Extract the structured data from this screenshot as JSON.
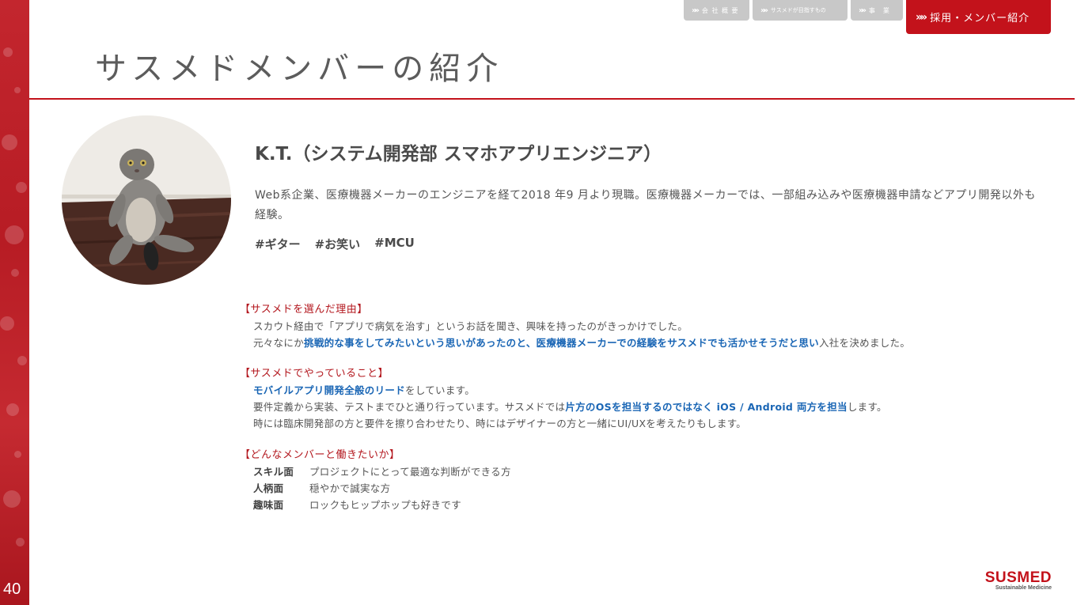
{
  "page_number": "40",
  "nav": {
    "tabs": [
      {
        "label": "会 社 概 要"
      },
      {
        "label": "サスメドが目指すもの"
      },
      {
        "label": "事　業"
      },
      {
        "label": "採用・メンバー紹介"
      }
    ]
  },
  "page_title": "サスメドメンバーの紹介",
  "member": {
    "name": "K.T.（システム開発部 スマホアプリエンジニア）",
    "bio": "Web系企業、医療機器メーカーのエンジニアを経て2018 年9 月より現職。医療機器メーカーでは、一部組み込みや医療機器申請などアプリ開発以外も経験。",
    "tags": [
      "#ギター",
      "#お笑い",
      "#MCU"
    ]
  },
  "sections": {
    "reason": {
      "heading": "【サスメドを選んだ理由】",
      "line1": "スカウト経由で「アプリで病気を治す」というお話を聞き、興味を持ったのがきっかけでした。",
      "line2_pre": "元々なにか",
      "line2_hl": "挑戦的な事をしてみたいという思いがあったのと、医療機器メーカーでの経験をサスメドでも活かせそうだと思い",
      "line2_post": "入社を決めました。"
    },
    "work": {
      "heading": "【サスメドでやっていること】",
      "line1_hl": "モバイルアプリ開発全般のリード",
      "line1_post": "をしています。",
      "line2_pre": "要件定義から実装、テストまでひと通り行っています。サスメドでは",
      "line2_hl": "片方のOSを担当するのではなく iOS / Android 両方を担当",
      "line2_post": "します。",
      "line3": "時には臨床開発部の方と要件を擦り合わせたり、時にはデザイナーの方と一緒にUI/UXを考えたりもします。"
    },
    "wish": {
      "heading": "【どんなメンバーと働きたいか】",
      "items": [
        {
          "key": "スキル面",
          "value": "プロジェクトにとって最適な判断ができる方"
        },
        {
          "key": "人柄面",
          "value": "穏やかで誠実な方"
        },
        {
          "key": "趣味面",
          "value": "ロックもヒップホップも好きです"
        }
      ]
    }
  },
  "brand": {
    "name": "SUSMED",
    "tagline": "Sustainable Medicine"
  },
  "colors": {
    "accent": "#c3121b",
    "highlight": "#1a66b5",
    "nav_inactive": "#c8c8c8"
  }
}
